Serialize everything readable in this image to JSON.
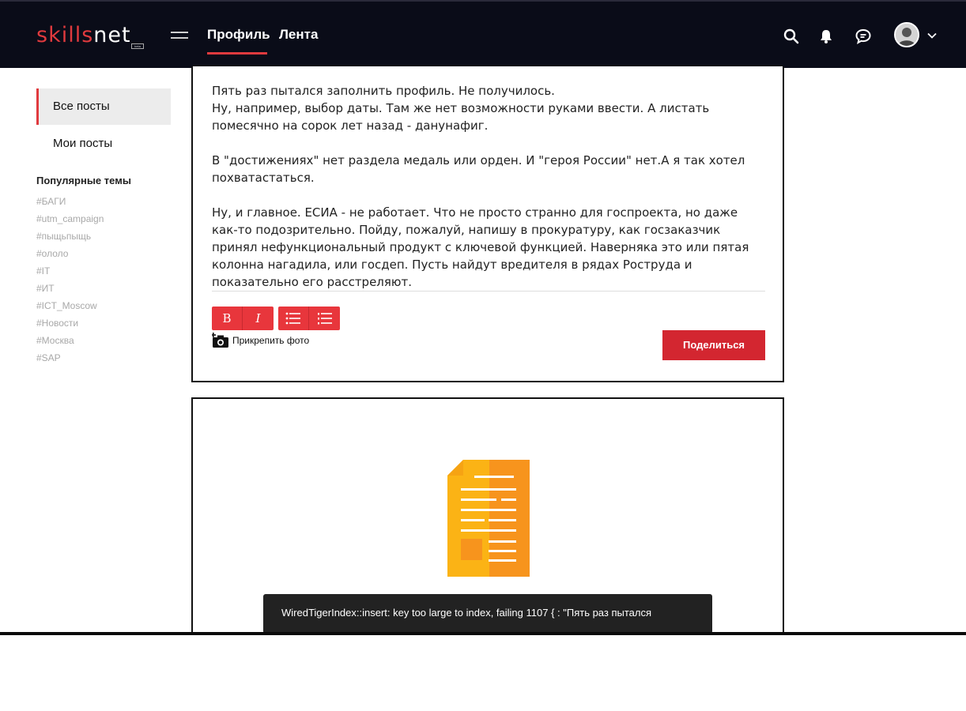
{
  "header": {
    "logo_brand": "skills",
    "logo_net": "net",
    "logo_badge": "beta",
    "nav_tabs": [
      {
        "label": "Профиль",
        "active": true
      },
      {
        "label": "Лента",
        "active": false
      }
    ],
    "icons": [
      "search-icon",
      "bell-icon",
      "chat-icon",
      "avatar",
      "chevron-down-icon"
    ]
  },
  "sidebar": {
    "items": [
      {
        "label": "Все посты",
        "active": true
      },
      {
        "label": "Мои посты",
        "active": false
      }
    ],
    "popular_title": "Популярные темы",
    "tags": [
      "#БАГИ",
      "#utm_campaign",
      "#пыщьпыщь",
      "#ололо",
      "#IT",
      "#ИТ",
      "#ICT_Moscow",
      "#Новости",
      "#Москва",
      "#SAP"
    ]
  },
  "editor": {
    "paragraphs": [
      [
        "Пять раз пытался заполнить профиль. Не получилось.",
        "Ну, например, выбор даты. Там же нет возможности руками ввести. А листать помесячно на сорок лет назад - данунафиг."
      ],
      [
        "В \"достижениях\" нет раздела медаль или орден. И \"героя России\" нет.А я так хотел похватастаться."
      ],
      [
        "Ну, и главное. ЕСИА - не работает. Что не просто странно для госпроекта, но даже как-то подозрительно. Пойду, пожалуй, напишу в прокуратуру, как госзаказчик принял нефункциональный продукт с ключевой функцией. Наверняка это или пятая колонна нагадила, или госдеп. Пусть найдут вредителя в рядах Роструда и показательно его расстреляют."
      ]
    ],
    "toolbar": {
      "bold": "B",
      "italic": "I"
    },
    "attach_label": "Прикрепить фото",
    "share_label": "Поделиться"
  },
  "toast": {
    "message": "WiredTigerIndex::insert: key too large to index, failing  1107 { : \"Пять раз пытался"
  },
  "colors": {
    "accent": "#e03a3e",
    "header_bg": "#0a0c18",
    "doc_orange": "#f7941d",
    "doc_yellow": "#fbb315"
  }
}
